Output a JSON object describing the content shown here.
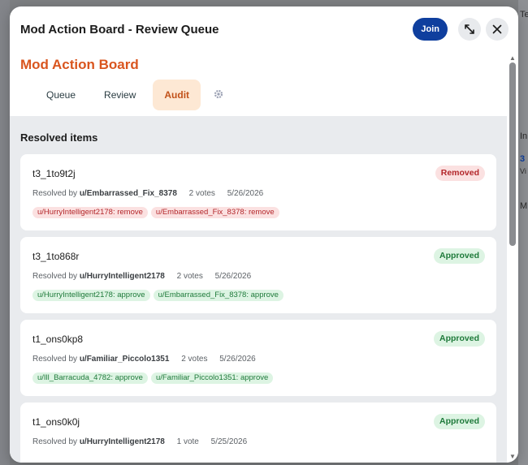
{
  "modal": {
    "title": "Mod Action Board - Review Queue",
    "join_label": "Join",
    "board_title": "Mod Action Board"
  },
  "tabs": [
    {
      "label": "Queue"
    },
    {
      "label": "Review"
    },
    {
      "label": "Audit"
    }
  ],
  "section_title": "Resolved items",
  "resolved_prefix": "Resolved by",
  "items": [
    {
      "id": "t3_1to9t2j",
      "resolved_by": "u/Embarrassed_Fix_8378",
      "votes": "2 votes",
      "date": "5/26/2026",
      "status": "Removed",
      "vote_chips": [
        "u/HurryIntelligent2178: remove",
        "u/Embarrassed_Fix_8378: remove"
      ]
    },
    {
      "id": "t3_1to868r",
      "resolved_by": "u/HurryIntelligent2178",
      "votes": "2 votes",
      "date": "5/26/2026",
      "status": "Approved",
      "vote_chips": [
        "u/HurryIntelligent2178: approve",
        "u/Embarrassed_Fix_8378: approve"
      ]
    },
    {
      "id": "t1_ons0kp8",
      "resolved_by": "u/Familiar_Piccolo1351",
      "votes": "2 votes",
      "date": "5/26/2026",
      "status": "Approved",
      "vote_chips": [
        "u/Ill_Barracuda_4782: approve",
        "u/Familiar_Piccolo1351: approve"
      ]
    },
    {
      "id": "t1_ons0k0j",
      "resolved_by": "u/HurryIntelligent2178",
      "votes": "1 vote",
      "date": "5/25/2026",
      "status": "Approved",
      "vote_chips": []
    }
  ],
  "background": {
    "right_edge_text": [
      "Te",
      "In",
      "3",
      "Vi",
      "M"
    ]
  },
  "colors": {
    "accent_orange": "#d9551e",
    "join_blue": "#0f3f9e",
    "removed_red": "#b3262a",
    "approved_green": "#1e7a3a"
  }
}
